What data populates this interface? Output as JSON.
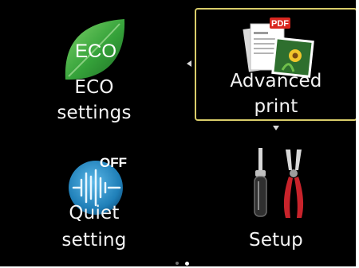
{
  "menu": {
    "eco": {
      "icon_text": "ECO",
      "label_line1": "ECO",
      "label_line2": "settings",
      "icon": "eco-leaf-icon",
      "icon_color": "#3aa33a"
    },
    "advanced_print": {
      "label_line1": "Advanced",
      "label_line2": "print",
      "icon": "pdf-photo-icon",
      "badge_text": "PDF",
      "selected": true,
      "highlight_color": "#d9cd6a"
    },
    "quiet": {
      "icon_text": "OFF",
      "label_line1": "Quiet",
      "label_line2": "setting",
      "icon": "quiet-sound-wave-icon",
      "icon_color": "#1f7fb8"
    },
    "setup": {
      "label": "Setup",
      "icon": "tools-icon"
    }
  },
  "navigation": {
    "left_arrow": "chevron-left-icon",
    "down_arrow": "chevron-down-icon",
    "page_indicator": {
      "pages": 2,
      "current": 2
    }
  },
  "colors": {
    "background": "#000000",
    "text": "#f4f4f4"
  }
}
